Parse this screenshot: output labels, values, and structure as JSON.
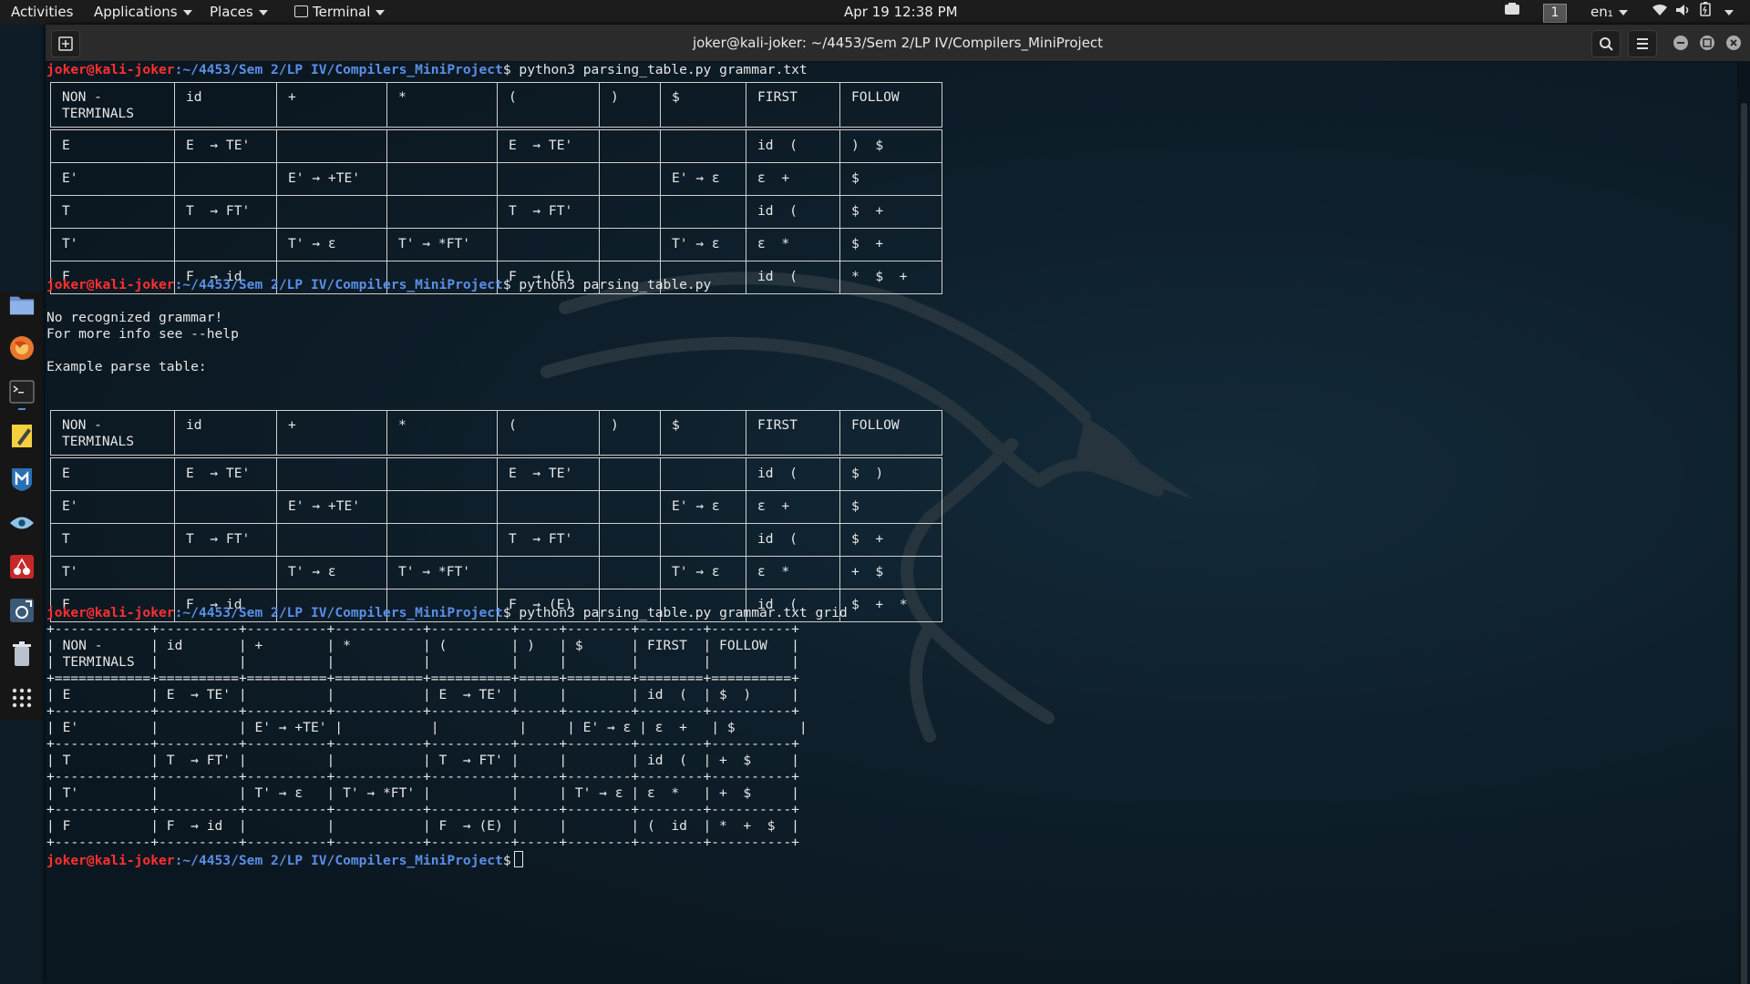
{
  "topbar": {
    "activities": "Activities",
    "applications": "Applications",
    "places": "Places",
    "terminal": "Terminal",
    "clock": "Apr 19  12:38 PM",
    "workspace": "1",
    "language": "en₁"
  },
  "window": {
    "title": "joker@kali-joker: ~/4453/Sem 2/LP IV/Compilers_MiniProject"
  },
  "prompt": {
    "user": "joker@kali-joker",
    "path": ":~/4453/Sem 2/LP IV/Compilers_MiniProject",
    "dollar": "$"
  },
  "commands": [
    " python3 parsing_table.py grammar.txt",
    " python3 parsing_table.py",
    " python3 parsing_table.py grammar.txt grid",
    " "
  ],
  "messages": {
    "no_grammar": "No recognized grammar!",
    "more_info": "For more info see --help",
    "example": "Example parse table:"
  },
  "table_headers": [
    "NON -\nTERMINALS",
    "id",
    "+",
    "*",
    "(",
    ")",
    "$",
    "FIRST",
    "FOLLOW"
  ],
  "table1_rows": [
    [
      "E",
      "E  → TE'",
      "",
      "",
      "E  → TE'",
      "",
      "",
      "id  (",
      ")  $"
    ],
    [
      "E'",
      "",
      "E' → +TE'",
      "",
      "",
      "",
      "E' → ε",
      "ε  +",
      "$"
    ],
    [
      "T",
      "T  → FT'",
      "",
      "",
      "T  → FT'",
      "",
      "",
      "id  (",
      "$  +"
    ],
    [
      "T'",
      "",
      "T' → ε",
      "T' → *FT'",
      "",
      "",
      "T' → ε",
      "ε  *",
      "$  +"
    ],
    [
      "F",
      "F  → id",
      "",
      "",
      "F  → (E)",
      "",
      "",
      "id  (",
      "*  $  +"
    ]
  ],
  "table2_rows": [
    [
      "E",
      "E  → TE'",
      "",
      "",
      "E  → TE'",
      "",
      "",
      "id  (",
      "$  )"
    ],
    [
      "E'",
      "",
      "E' → +TE'",
      "",
      "",
      "",
      "E' → ε",
      "ε  +",
      "$"
    ],
    [
      "T",
      "T  → FT'",
      "",
      "",
      "T  → FT'",
      "",
      "",
      "id  (",
      "$  +"
    ],
    [
      "T'",
      "",
      "T' → ε",
      "T' → *FT'",
      "",
      "",
      "T' → ε",
      "ε  *",
      "+  $"
    ],
    [
      "F",
      "F  → id",
      "",
      "",
      "F  → (E)",
      "",
      "",
      "id  (",
      "$  +  *"
    ]
  ],
  "grid_lines": [
    "+------------+----------+----------+-----------+----------+-----+--------+--------+----------+",
    "| NON -      | id       | +        | *         | (        | )   | $      | FIRST  | FOLLOW   |",
    "| TERMINALS  |          |          |           |          |     |        |        |          |",
    "+============+==========+==========+===========+==========+=====+========+========+==========+",
    "| E          | E  → TE' |          |           | E  → TE' |     |        | id  (  | $  )     |",
    "+------------+----------+----------+-----------+----------+-----+--------+--------+----------+",
    "| E'         |          | E' → +TE' |           |          |     | E' → ε | ε  +   | $        |",
    "+------------+----------+----------+-----------+----------+-----+--------+--------+----------+",
    "| T          | T  → FT' |          |           | T  → FT' |     |        | id  (  | +  $     |",
    "+------------+----------+----------+-----------+----------+-----+--------+--------+----------+",
    "| T'         |          | T' → ε   | T' → *FT' |          |     | T' → ε | ε  *   | +  $     |",
    "+------------+----------+----------+-----------+----------+-----+--------+--------+----------+",
    "| F          | F  → id  |          |           | F  → (E) |     |        | (  id  | *  +  $  |",
    "+------------+----------+----------+-----------+----------+-----+--------+--------+----------+"
  ],
  "dock_icons": [
    "files-icon",
    "firefox-icon",
    "terminal-icon",
    "notes-icon",
    "metasploit-icon",
    "eye-icon",
    "cherrytree-icon",
    "burpsuite-icon",
    "trash-icon",
    "app-grid-icon"
  ],
  "colors": {
    "prompt_user": "#ff3030",
    "prompt_path": "#5c8ee6",
    "terminal_bg": "#0c1821",
    "topbar_bg": "#1c1c1c"
  }
}
